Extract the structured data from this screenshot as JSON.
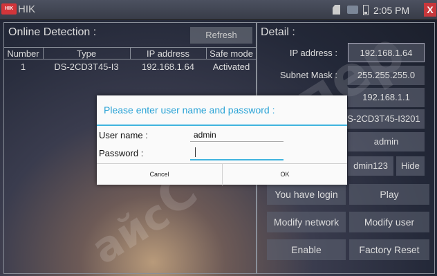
{
  "topbar": {
    "logo_text": "HIK",
    "app_title": "HIK",
    "clock": "2:05 PM",
    "close_glyph": "X"
  },
  "online": {
    "title": "Online Detection :",
    "refresh_label": "Refresh",
    "columns": [
      "Number",
      "Type",
      "IP address",
      "Safe mode"
    ],
    "rows": [
      {
        "number": "1",
        "type": "DS-2CD3T45-I3",
        "ip": "192.168.1.64",
        "safe_mode": "Activated"
      }
    ]
  },
  "detail": {
    "title": "Detail :",
    "ip_label": "IP address :",
    "ip_value": "192.168.1.64",
    "subnet_label": "Subnet Mask :",
    "subnet_value": "255.255.255.0",
    "gateway_value": "192.168.1.1",
    "model_value": "S-2CD3T45-I3201",
    "user_value": "admin",
    "password_value": "dmin123",
    "hide_label": "Hide",
    "login_status": "You have login",
    "play_label": "Play",
    "modify_network_label": "Modify network",
    "modify_user_label": "Modify user",
    "enable_label": "Enable",
    "factory_reset_label": "Factory Reset"
  },
  "dialog": {
    "title": "Please enter user name and password :",
    "username_label": "User name :",
    "username_value": "admin",
    "password_label": "Password :",
    "password_value": "",
    "cancel_label": "Cancel",
    "ok_label": "OK"
  },
  "watermark": {
    "text_1": "супер",
    "text_2": "айс",
    "text_3": "С"
  }
}
